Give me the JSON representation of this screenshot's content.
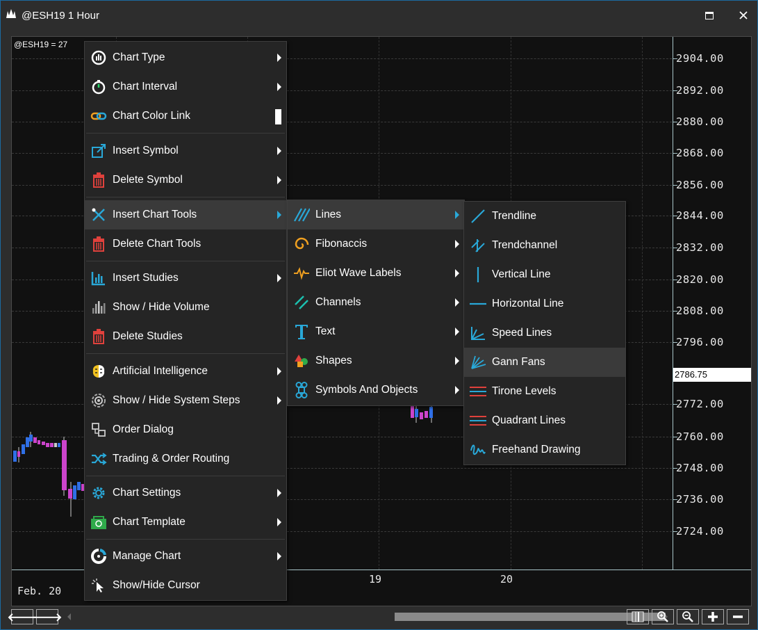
{
  "window": {
    "title": "@ESH19 1 Hour"
  },
  "chart": {
    "symbol_label": "@ESH19 = 27",
    "price_axis": [
      "2904.00",
      "2892.00",
      "2880.00",
      "2868.00",
      "2856.00",
      "2844.00",
      "2832.00",
      "2820.00",
      "2808.00",
      "2796.00",
      "2772.00",
      "2760.00",
      "2748.00",
      "2736.00",
      "2724.00"
    ],
    "current_price": "2786.75",
    "time_axis": {
      "left": "Feb. 20",
      "t19": "19",
      "t20": "20"
    }
  },
  "context_menu": {
    "items": [
      {
        "label": "Chart Type",
        "icon": "chart-type-icon"
      },
      {
        "label": "Chart Interval",
        "icon": "stopwatch-icon"
      },
      {
        "label": "Chart Color Link",
        "icon": "link-icon"
      },
      {
        "label": "Insert Symbol",
        "icon": "insert-symbol-icon"
      },
      {
        "label": "Delete Symbol",
        "icon": "trash-icon"
      },
      {
        "label": "Insert Chart Tools",
        "icon": "chart-tools-icon"
      },
      {
        "label": "Delete Chart Tools",
        "icon": "trash-icon"
      },
      {
        "label": "Insert Studies",
        "icon": "studies-icon"
      },
      {
        "label": "Show / Hide Volume",
        "icon": "volume-icon"
      },
      {
        "label": "Delete Studies",
        "icon": "trash-icon"
      },
      {
        "label": "Artificial Intelligence",
        "icon": "brain-icon"
      },
      {
        "label": "Show / Hide System Steps",
        "icon": "target-icon"
      },
      {
        "label": "Order Dialog",
        "icon": "order-dialog-icon"
      },
      {
        "label": "Trading & Order Routing",
        "icon": "shuffle-icon"
      },
      {
        "label": "Chart Settings",
        "icon": "gear-icon"
      },
      {
        "label": "Chart Template",
        "icon": "template-icon"
      },
      {
        "label": "Manage Chart",
        "icon": "manage-chart-icon"
      },
      {
        "label": "Show/Hide Cursor",
        "icon": "cursor-icon"
      }
    ]
  },
  "tools_menu": {
    "items": [
      {
        "label": "Lines",
        "icon": "lines-icon"
      },
      {
        "label": "Fibonaccis",
        "icon": "spiral-icon"
      },
      {
        "label": "Eliot Wave Labels",
        "icon": "wave-icon"
      },
      {
        "label": "Channels",
        "icon": "channels-icon"
      },
      {
        "label": "Text",
        "icon": "text-icon"
      },
      {
        "label": "Shapes",
        "icon": "shapes-icon"
      },
      {
        "label": "Symbols And Objects",
        "icon": "command-icon"
      }
    ]
  },
  "lines_menu": {
    "items": [
      {
        "label": "Trendline",
        "icon": "trendline-icon"
      },
      {
        "label": "Trendchannel",
        "icon": "trendchannel-icon"
      },
      {
        "label": "Vertical Line",
        "icon": "vertical-line-icon"
      },
      {
        "label": "Horizontal Line",
        "icon": "horizontal-line-icon"
      },
      {
        "label": "Speed Lines",
        "icon": "speed-lines-icon"
      },
      {
        "label": "Gann Fans",
        "icon": "gann-fans-icon"
      },
      {
        "label": "Tirone Levels",
        "icon": "tirone-levels-icon"
      },
      {
        "label": "Quadrant Lines",
        "icon": "quadrant-lines-icon"
      },
      {
        "label": "Freehand Drawing",
        "icon": "freehand-icon"
      }
    ]
  },
  "colors": {
    "accent": "#29a8d8",
    "trash": "#e0413c",
    "highlight": "#3a3a3a"
  }
}
